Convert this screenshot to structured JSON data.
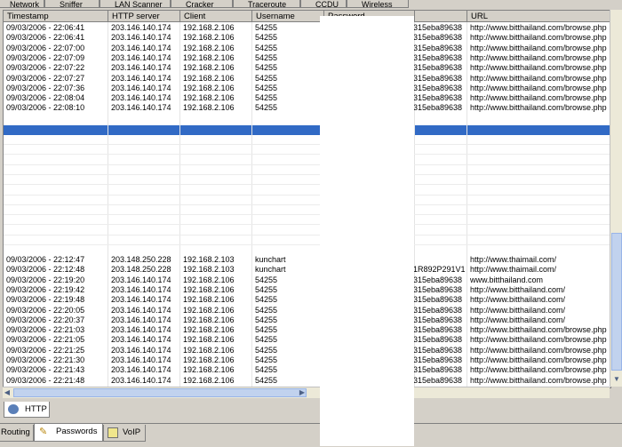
{
  "top_tabs": [
    {
      "label": "Network",
      "icon": "network-icon"
    },
    {
      "label": "Sniffer",
      "icon": "sniffer-icon"
    },
    {
      "label": "LAN Scanner",
      "icon": "scanner-icon"
    },
    {
      "label": "Cracker",
      "icon": "cracker-icon"
    },
    {
      "label": "Traceroute",
      "icon": "traceroute-icon"
    },
    {
      "label": "CCDU",
      "icon": "ccdu-icon"
    },
    {
      "label": "Wireless",
      "icon": "wireless-icon"
    }
  ],
  "columns": [
    "Timestamp",
    "HTTP server",
    "Client",
    "Username",
    "Password",
    "",
    "URL"
  ],
  "rows_top": [
    [
      "09/03/2006 - 22:06:41",
      "203.146.140.174",
      "192.168.2.106",
      "54255",
      "315eba89638",
      "http://www.bitthailand.com/browse.php"
    ],
    [
      "09/03/2006 - 22:06:41",
      "203.146.140.174",
      "192.168.2.106",
      "54255",
      "315eba89638",
      "http://www.bitthailand.com/browse.php"
    ],
    [
      "09/03/2006 - 22:07:00",
      "203.146.140.174",
      "192.168.2.106",
      "54255",
      "315eba89638",
      "http://www.bitthailand.com/browse.php"
    ],
    [
      "09/03/2006 - 22:07:09",
      "203.146.140.174",
      "192.168.2.106",
      "54255",
      "315eba89638",
      "http://www.bitthailand.com/browse.php"
    ],
    [
      "09/03/2006 - 22:07:22",
      "203.146.140.174",
      "192.168.2.106",
      "54255",
      "315eba89638",
      "http://www.bitthailand.com/browse.php"
    ],
    [
      "09/03/2006 - 22:07:27",
      "203.146.140.174",
      "192.168.2.106",
      "54255",
      "315eba89638",
      "http://www.bitthailand.com/browse.php"
    ],
    [
      "09/03/2006 - 22:07:36",
      "203.146.140.174",
      "192.168.2.106",
      "54255",
      "315eba89638",
      "http://www.bitthailand.com/browse.php"
    ],
    [
      "09/03/2006 - 22:08:04",
      "203.146.140.174",
      "192.168.2.106",
      "54255",
      "315eba89638",
      "http://www.bitthailand.com/browse.php"
    ],
    [
      "09/03/2006 - 22:08:10",
      "203.146.140.174",
      "192.168.2.106",
      "54255",
      "315eba89638",
      "http://www.bitthailand.com/browse.php"
    ]
  ],
  "rows_bottom": [
    [
      "09/03/2006 - 22:12:47",
      "203.148.250.228",
      "192.168.2.103",
      "kunchart",
      "",
      "http://www.thaimail.com/"
    ],
    [
      "09/03/2006 - 22:12:48",
      "203.148.250.228",
      "192.168.2.103",
      "kunchart",
      "1R892P291V1",
      "http://www.thaimail.com/"
    ],
    [
      "09/03/2006 - 22:19:20",
      "203.146.140.174",
      "192.168.2.106",
      "54255",
      "315eba89638",
      "www.bitthailand.com"
    ],
    [
      "09/03/2006 - 22:19:42",
      "203.146.140.174",
      "192.168.2.106",
      "54255",
      "315eba89638",
      "http://www.bitthailand.com/"
    ],
    [
      "09/03/2006 - 22:19:48",
      "203.146.140.174",
      "192.168.2.106",
      "54255",
      "315eba89638",
      "http://www.bitthailand.com/"
    ],
    [
      "09/03/2006 - 22:20:05",
      "203.146.140.174",
      "192.168.2.106",
      "54255",
      "315eba89638",
      "http://www.bitthailand.com/"
    ],
    [
      "09/03/2006 - 22:20:37",
      "203.146.140.174",
      "192.168.2.106",
      "54255",
      "315eba89638",
      "http://www.bitthailand.com/"
    ],
    [
      "09/03/2006 - 22:21:03",
      "203.146.140.174",
      "192.168.2.106",
      "54255",
      "315eba89638",
      "http://www.bitthailand.com/browse.php"
    ],
    [
      "09/03/2006 - 22:21:05",
      "203.146.140.174",
      "192.168.2.106",
      "54255",
      "315eba89638",
      "http://www.bitthailand.com/browse.php"
    ],
    [
      "09/03/2006 - 22:21:25",
      "203.146.140.174",
      "192.168.2.106",
      "54255",
      "315eba89638",
      "http://www.bitthailand.com/browse.php"
    ],
    [
      "09/03/2006 - 22:21:30",
      "203.146.140.174",
      "192.168.2.106",
      "54255",
      "315eba89638",
      "http://www.bitthailand.com/browse.php"
    ],
    [
      "09/03/2006 - 22:21:43",
      "203.146.140.174",
      "192.168.2.106",
      "54255",
      "315eba89638",
      "http://www.bitthailand.com/browse.php"
    ],
    [
      "09/03/2006 - 22:21:48",
      "203.146.140.174",
      "192.168.2.106",
      "54255",
      "315eba89638",
      "http://www.bitthailand.com/browse.php"
    ]
  ],
  "sub_tab": {
    "label": "HTTP",
    "icon": "http-icon"
  },
  "bottom_tabs": [
    {
      "label": "Routing",
      "icon": "routing-icon",
      "active": false
    },
    {
      "label": "Passwords",
      "icon": "key-icon",
      "active": true
    },
    {
      "label": "VoIP",
      "icon": "voip-icon",
      "active": false
    }
  ],
  "colors": {
    "selection": "#316ac5",
    "window": "#d4d0c8",
    "scroll_thumb": "#c1d2ee"
  }
}
